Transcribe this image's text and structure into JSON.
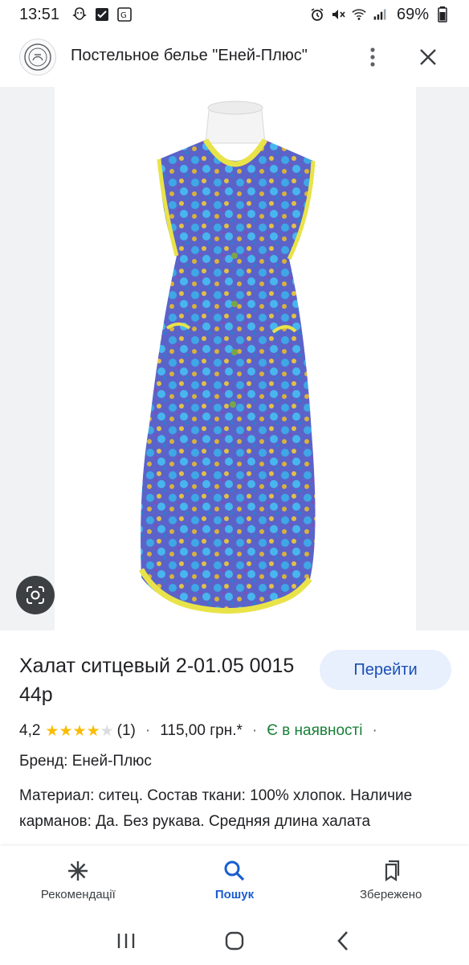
{
  "status_bar": {
    "time": "13:51",
    "battery": "69%",
    "icons": [
      "snapchat-ghost-icon",
      "checkbox-icon",
      "translate-icon",
      "alarm-icon",
      "mute-icon",
      "wifi-icon",
      "signal-icon",
      "battery-icon"
    ]
  },
  "header": {
    "title": "Постельное белье \"Еней-Плюс\""
  },
  "product": {
    "title": "Халат ситцевый 2-01.05 0015 44р",
    "go_button": "Перейти",
    "rating": "4,2",
    "stars": 4.2,
    "reviews": "(1)",
    "price": "115,00 грн.*",
    "availability": "Є в наявності",
    "brand": "Бренд: Еней-Плюс",
    "description": "Материал: ситец. Состав ткани: 100% хлопок. Наличие карманов: Да. Без рукава. Средняя длина халата"
  },
  "bottom_nav": {
    "items": [
      {
        "label": "Рекомендації",
        "icon": "asterisk-icon"
      },
      {
        "label": "Пошук",
        "icon": "search-icon"
      },
      {
        "label": "Збережено",
        "icon": "bookmarks-icon"
      }
    ],
    "active_index": 1
  },
  "colors": {
    "accent": "#1a5dd0",
    "button_bg": "#e8f0fe",
    "availability": "#188038",
    "star": "#fbbc04"
  }
}
